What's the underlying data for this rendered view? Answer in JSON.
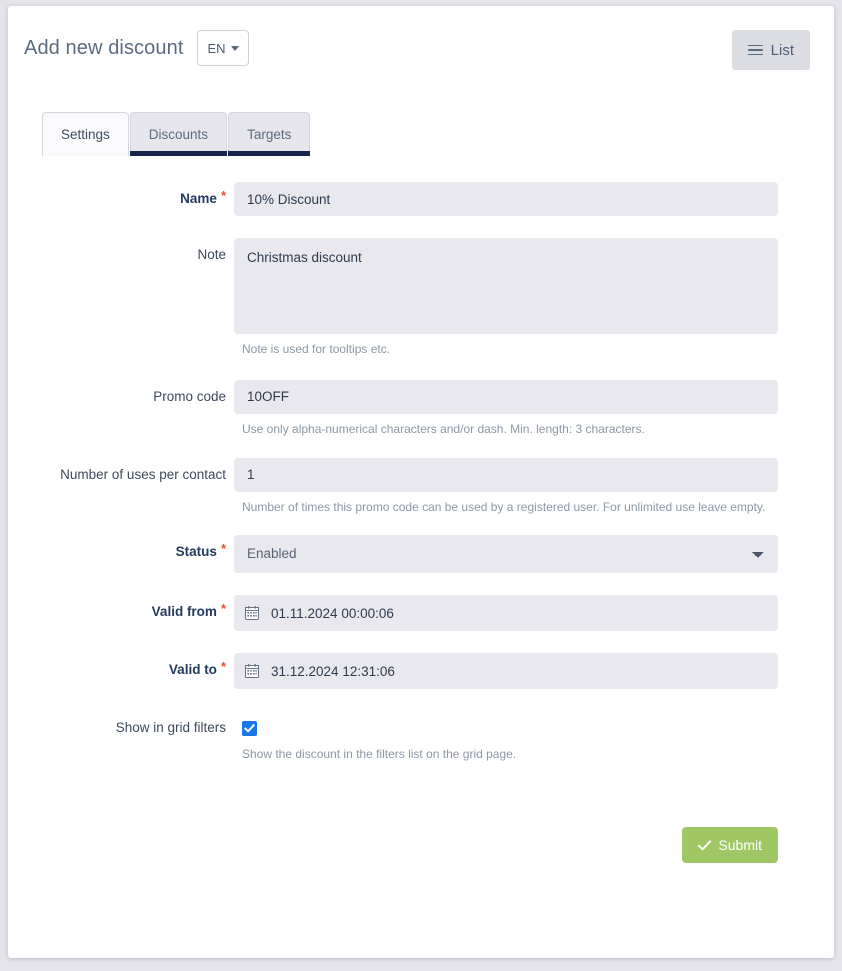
{
  "header": {
    "title": "Add new discount",
    "language_button": "EN",
    "language_caret_icon": "caret-down-icon",
    "list_button": "List",
    "list_icon": "hamburger-icon"
  },
  "tabs": [
    {
      "label": "Settings",
      "active": true
    },
    {
      "label": "Discounts",
      "active": false
    },
    {
      "label": "Targets",
      "active": false
    }
  ],
  "form": {
    "name": {
      "label": "Name",
      "required_marker": "*",
      "value": "10% Discount"
    },
    "note": {
      "label": "Note",
      "value": "Christmas discount",
      "help": "Note is used for tooltips etc."
    },
    "promo_code": {
      "label": "Promo code",
      "value": "10OFF",
      "help": "Use only alpha-numerical characters and/or dash. Min. length: 3 characters."
    },
    "uses_per_contact": {
      "label": "Number of uses per contact",
      "value": "1",
      "help": "Number of times this promo code can be used by a registered user. For unlimited use leave empty."
    },
    "status": {
      "label": "Status",
      "required_marker": "*",
      "value": "Enabled",
      "options": [
        "Enabled"
      ],
      "chevron_icon": "chevron-down-icon"
    },
    "valid_from": {
      "label": "Valid from",
      "required_marker": "*",
      "value": "01.11.2024 00:00:06",
      "icon": "calendar-icon"
    },
    "valid_to": {
      "label": "Valid to",
      "required_marker": "*",
      "value": "31.12.2024 12:31:06",
      "icon": "calendar-icon"
    },
    "show_in_grid_filters": {
      "label": "Show in grid filters",
      "checked": true,
      "help": "Show the discount in the filters list on the grid page."
    }
  },
  "footer": {
    "submit_label": "Submit",
    "submit_icon": "check-icon"
  },
  "colors": {
    "page_background": "#e4e4ea",
    "card_background": "#ffffff",
    "input_background": "#e8e8ee",
    "tab_active_indicator": "#16264a",
    "required_asterisk": "#e8502a",
    "checkbox_accent": "#1877e8",
    "submit_green": "#9fc864",
    "list_button_background": "#dcdce3"
  }
}
